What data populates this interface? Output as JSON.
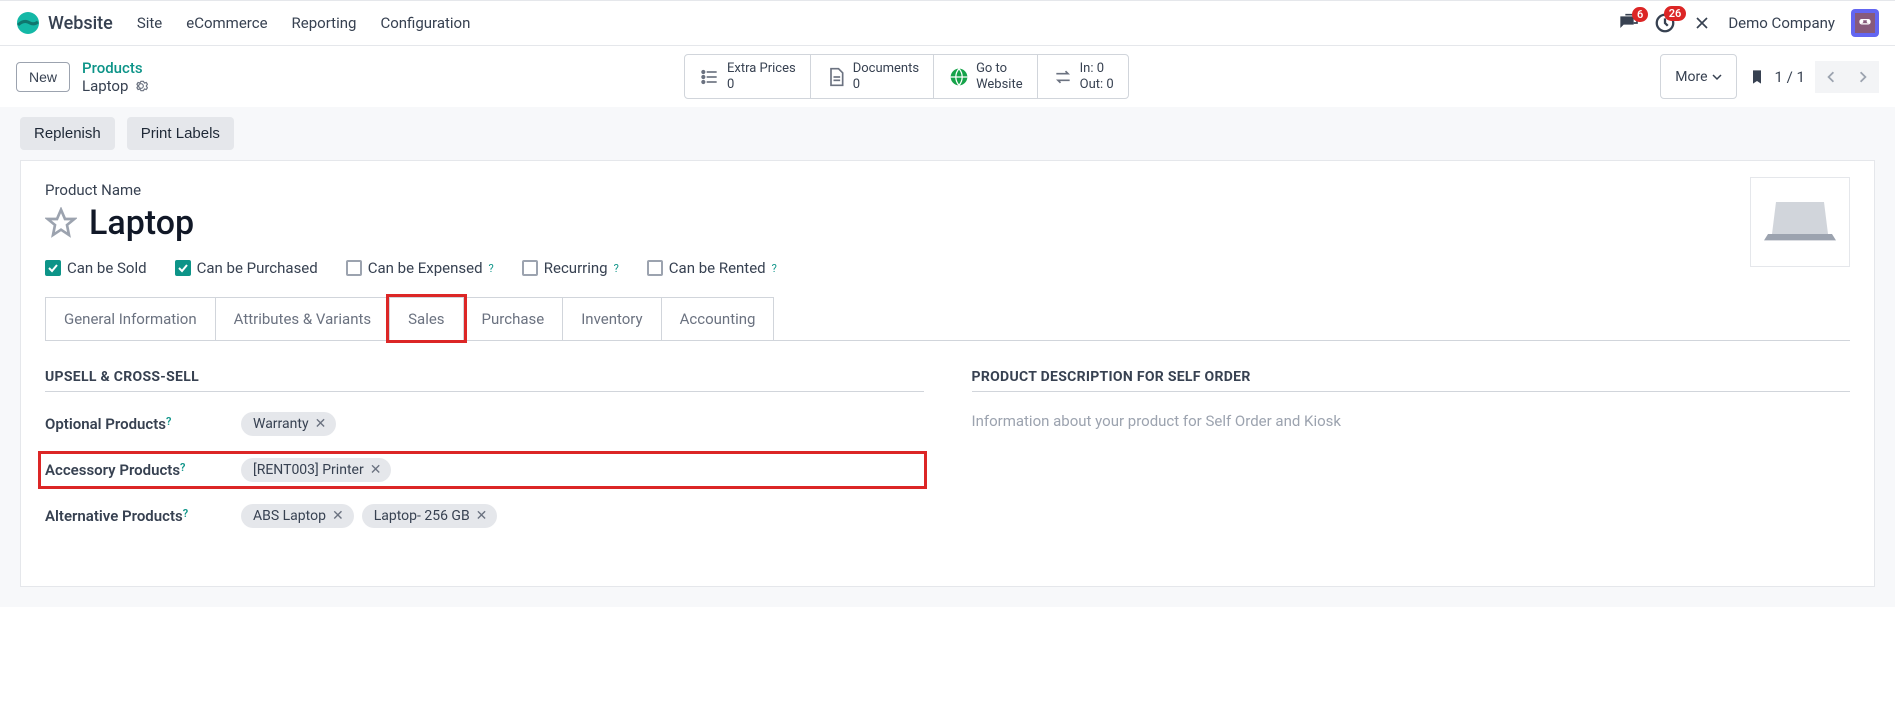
{
  "nav": {
    "app_name": "Website",
    "links": [
      "Site",
      "eCommerce",
      "Reporting",
      "Configuration"
    ],
    "chat_badge": "6",
    "activity_badge": "26",
    "company": "Demo Company"
  },
  "control": {
    "new_label": "New",
    "breadcrumb_parent": "Products",
    "breadcrumb_current": "Laptop",
    "smart_buttons": {
      "extra_prices": {
        "label": "Extra Prices",
        "count": "0"
      },
      "documents": {
        "label": "Documents",
        "count": "0"
      },
      "website": {
        "label": "Go to",
        "sub": "Website"
      },
      "inventory": {
        "in_label": "In:",
        "in_val": "0",
        "out_label": "Out:",
        "out_val": "0"
      }
    },
    "more_label": "More",
    "pager": "1 / 1"
  },
  "actions": {
    "replenish": "Replenish",
    "print_labels": "Print Labels"
  },
  "form": {
    "name_label": "Product Name",
    "product_name": "Laptop",
    "checkboxes": {
      "sold": {
        "label": "Can be Sold",
        "checked": true
      },
      "purchased": {
        "label": "Can be Purchased",
        "checked": true
      },
      "expensed": {
        "label": "Can be Expensed",
        "checked": false
      },
      "recurring": {
        "label": "Recurring",
        "checked": false
      },
      "rented": {
        "label": "Can be Rented",
        "checked": false
      }
    },
    "tabs": [
      "General Information",
      "Attributes & Variants",
      "Sales",
      "Purchase",
      "Inventory",
      "Accounting"
    ],
    "active_tab_index": 2,
    "sales": {
      "upsell_title": "UPSELL & CROSS-SELL",
      "desc_title": "PRODUCT DESCRIPTION FOR SELF ORDER",
      "optional_label": "Optional Products",
      "accessory_label": "Accessory Products",
      "alternative_label": "Alternative Products",
      "optional_tags": [
        "Warranty"
      ],
      "accessory_tags": [
        "[RENT003] Printer"
      ],
      "alternative_tags": [
        "ABS Laptop",
        "Laptop- 256 GB"
      ],
      "desc_placeholder": "Information about your product for Self Order and Kiosk"
    }
  }
}
